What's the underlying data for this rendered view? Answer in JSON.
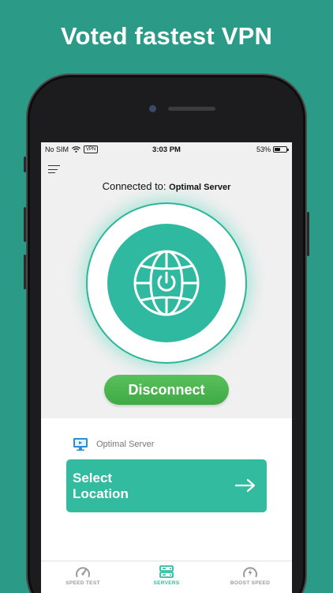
{
  "headline": "Voted fastest VPN",
  "status_bar": {
    "carrier": "No SIM",
    "vpn_badge": "VPN",
    "time": "3:03 PM",
    "battery": "53%",
    "battery_level": 0.53
  },
  "connection": {
    "label": "Connected to:",
    "server": "Optimal Server"
  },
  "disconnect_label": "Disconnect",
  "current_server": "Optimal Server",
  "select_location": {
    "line1": "Select",
    "line2": "Location"
  },
  "tabs": [
    {
      "label": "SPEED TEST",
      "icon": "speedometer-icon"
    },
    {
      "label": "SERVERS",
      "icon": "servers-icon"
    },
    {
      "label": "BOOST SPEED",
      "icon": "boost-speedometer-icon"
    }
  ],
  "active_tab": "SERVERS",
  "colors": {
    "background": "#2b9a86",
    "accent": "#2fb9a0",
    "disconnect": "#4cb552",
    "tab_active": "#2fb9a0",
    "tab_inactive": "#9a9a9a"
  }
}
